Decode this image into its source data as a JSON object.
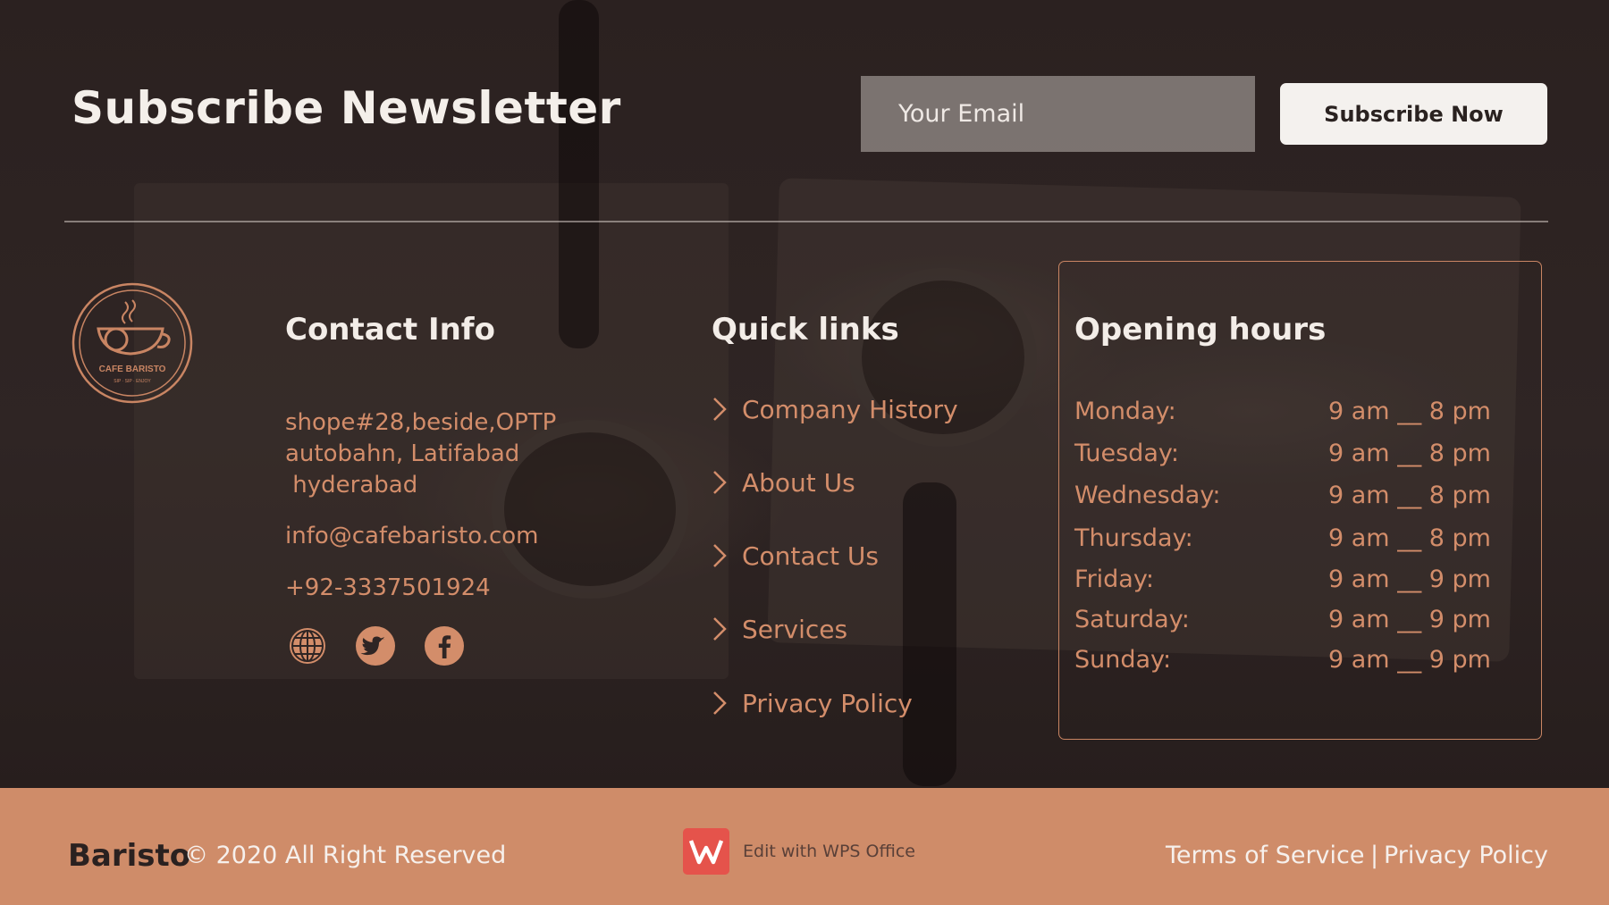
{
  "newsletter": {
    "title": "Subscribe Newsletter",
    "email_placeholder": "Your Email",
    "button_label": "Subscribe Now"
  },
  "logo": {
    "brand": "CAFE BARISTO",
    "tagline": "SIP · SIP · ENJOY"
  },
  "contact": {
    "title": "Contact Info",
    "address_lines": [
      "shope#28,beside,OPTP",
      "autobahn, Latifabad",
      " hyderabad"
    ],
    "email": "info@cafebaristo.com",
    "phone": "+92-3337501924",
    "social_icons": [
      "globe-icon",
      "twitter-icon",
      "facebook-icon"
    ]
  },
  "quick_links": {
    "title": "Quick links",
    "items": [
      "Company History",
      "About Us",
      "Contact Us",
      "Services",
      "Privacy Policy"
    ]
  },
  "hours": {
    "title": "Opening hours",
    "rows": [
      {
        "day": "Monday:",
        "time": "9 am __ 8 pm"
      },
      {
        "day": "Tuesday:",
        "time": "9 am __ 8 pm"
      },
      {
        "day": "Wednesday:",
        "time": "9 am __ 8 pm"
      },
      {
        "day": "Thursday:",
        "time": "9 am __ 8 pm"
      },
      {
        "day": "Friday:",
        "time": "9 am __ 9 pm"
      },
      {
        "day": "Saturday:",
        "time": "9 am __ 9 pm"
      },
      {
        "day": "Sunday:",
        "time": "9 am __ 9 pm"
      }
    ]
  },
  "footer": {
    "brand": "Baristo",
    "copyright": "© 2020 All Right Reserved",
    "wps_label": "Edit with WPS Office",
    "terms": "Terms of Service",
    "separator": "|",
    "privacy": "Privacy Policy"
  },
  "colors": {
    "accent": "#cf8c69",
    "text_accent": "#d38d6a",
    "background": "#2a201f",
    "heading": "#f3ede8"
  }
}
